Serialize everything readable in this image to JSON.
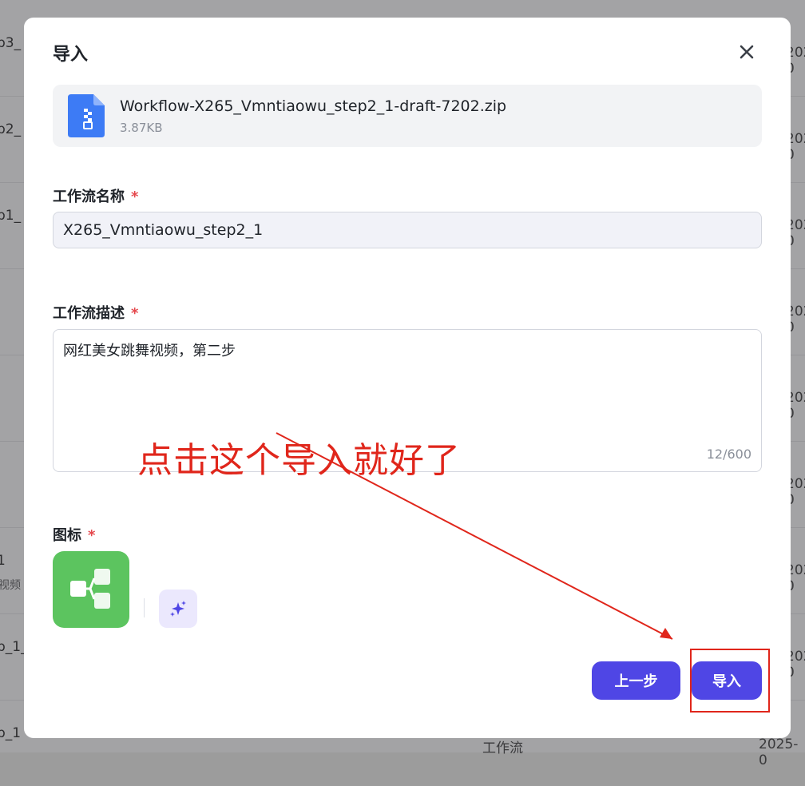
{
  "background": {
    "left_fragments": [
      "p3_",
      "p2_",
      "p1_",
      "",
      "",
      "",
      "1",
      "p_1_",
      "p_1"
    ],
    "left_sub": "视频",
    "right_fragment": "2025-0",
    "bottom_type": "工作流",
    "bottom_date": "2025-0"
  },
  "modal": {
    "title": "导入",
    "file": {
      "name": "Workflow-X265_Vmntiaowu_step2_1-draft-7202.zip",
      "size": "3.87KB"
    },
    "name_field": {
      "label": "工作流名称",
      "required_mark": "*",
      "value": "X265_Vmntiaowu_step2_1"
    },
    "desc_field": {
      "label": "工作流描述",
      "required_mark": "*",
      "value": "网红美女跳舞视频，第二步",
      "counter": "12/600"
    },
    "icon_field": {
      "label": "图标",
      "required_mark": "*"
    },
    "buttons": {
      "prev": "上一步",
      "import": "导入"
    }
  },
  "annotation": {
    "text": "点击这个导入就好了",
    "color": "#e0261b"
  },
  "colors": {
    "primary": "#4f46e5",
    "icon_green": "#5cc45f",
    "required": "#e5484d",
    "file_blue": "#3d7bf5"
  }
}
